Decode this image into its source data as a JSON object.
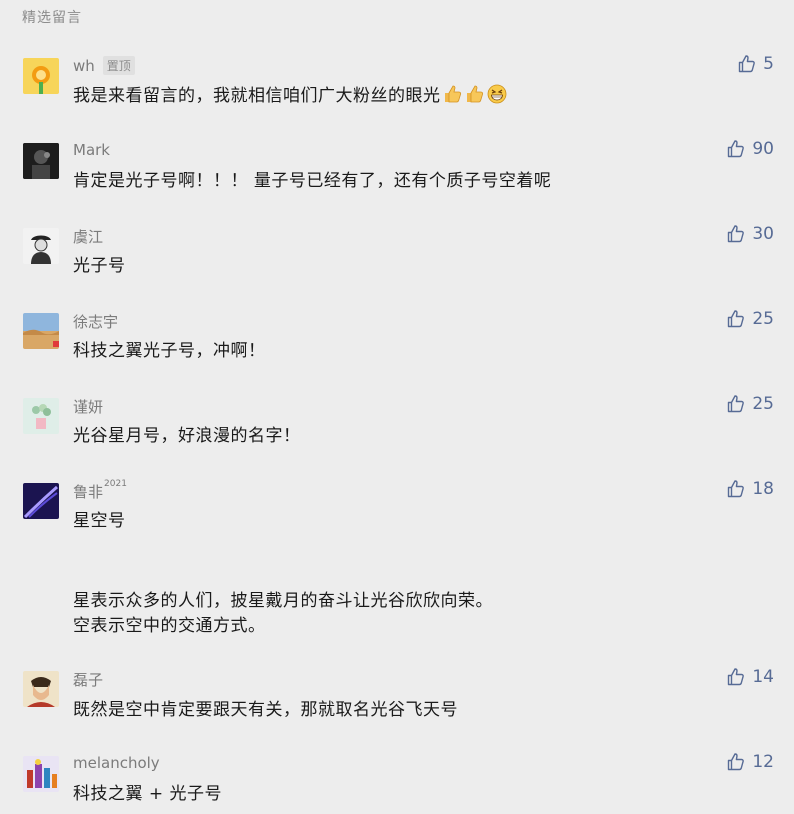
{
  "section_title": "精选留言",
  "comments": [
    {
      "name": "wh",
      "badge": "置顶",
      "text": "我是来看留言的，我就相信咱们广大粉丝的眼光",
      "likes": "5"
    },
    {
      "name": "Mark",
      "text": "肯定是光子号啊！！！ 量子号已经有了，还有个质子号空着呢",
      "likes": "90"
    },
    {
      "name": "虞江",
      "text": "光子号",
      "likes": "30"
    },
    {
      "name": "徐志宇",
      "text": "科技之翼光子号，冲啊！",
      "likes": "25"
    },
    {
      "name": "谨妍",
      "text": "光谷星月号，好浪漫的名字！",
      "likes": "25"
    },
    {
      "name": "鲁非",
      "name_sup": "2021",
      "text": "星空号",
      "text2": "星表示众多的人们，披星戴月的奋斗让光谷欣欣向荣。",
      "text3": "空表示空中的交通方式。",
      "likes": "18"
    },
    {
      "name": "磊子",
      "text": "既然是空中肯定要跟天有关，那就取名光谷飞天号",
      "likes": "14"
    },
    {
      "name": "melancholy",
      "text": "科技之翼 + 光子号",
      "likes": "12"
    }
  ],
  "colors": {
    "background": "#ededed",
    "nickname": "#7b7b7b",
    "like": "#576b95"
  },
  "icons": {
    "like": "thumbs-up-icon",
    "emoji_thumb": "thumbs-up-emoji",
    "emoji_grin": "grin-emoji"
  }
}
